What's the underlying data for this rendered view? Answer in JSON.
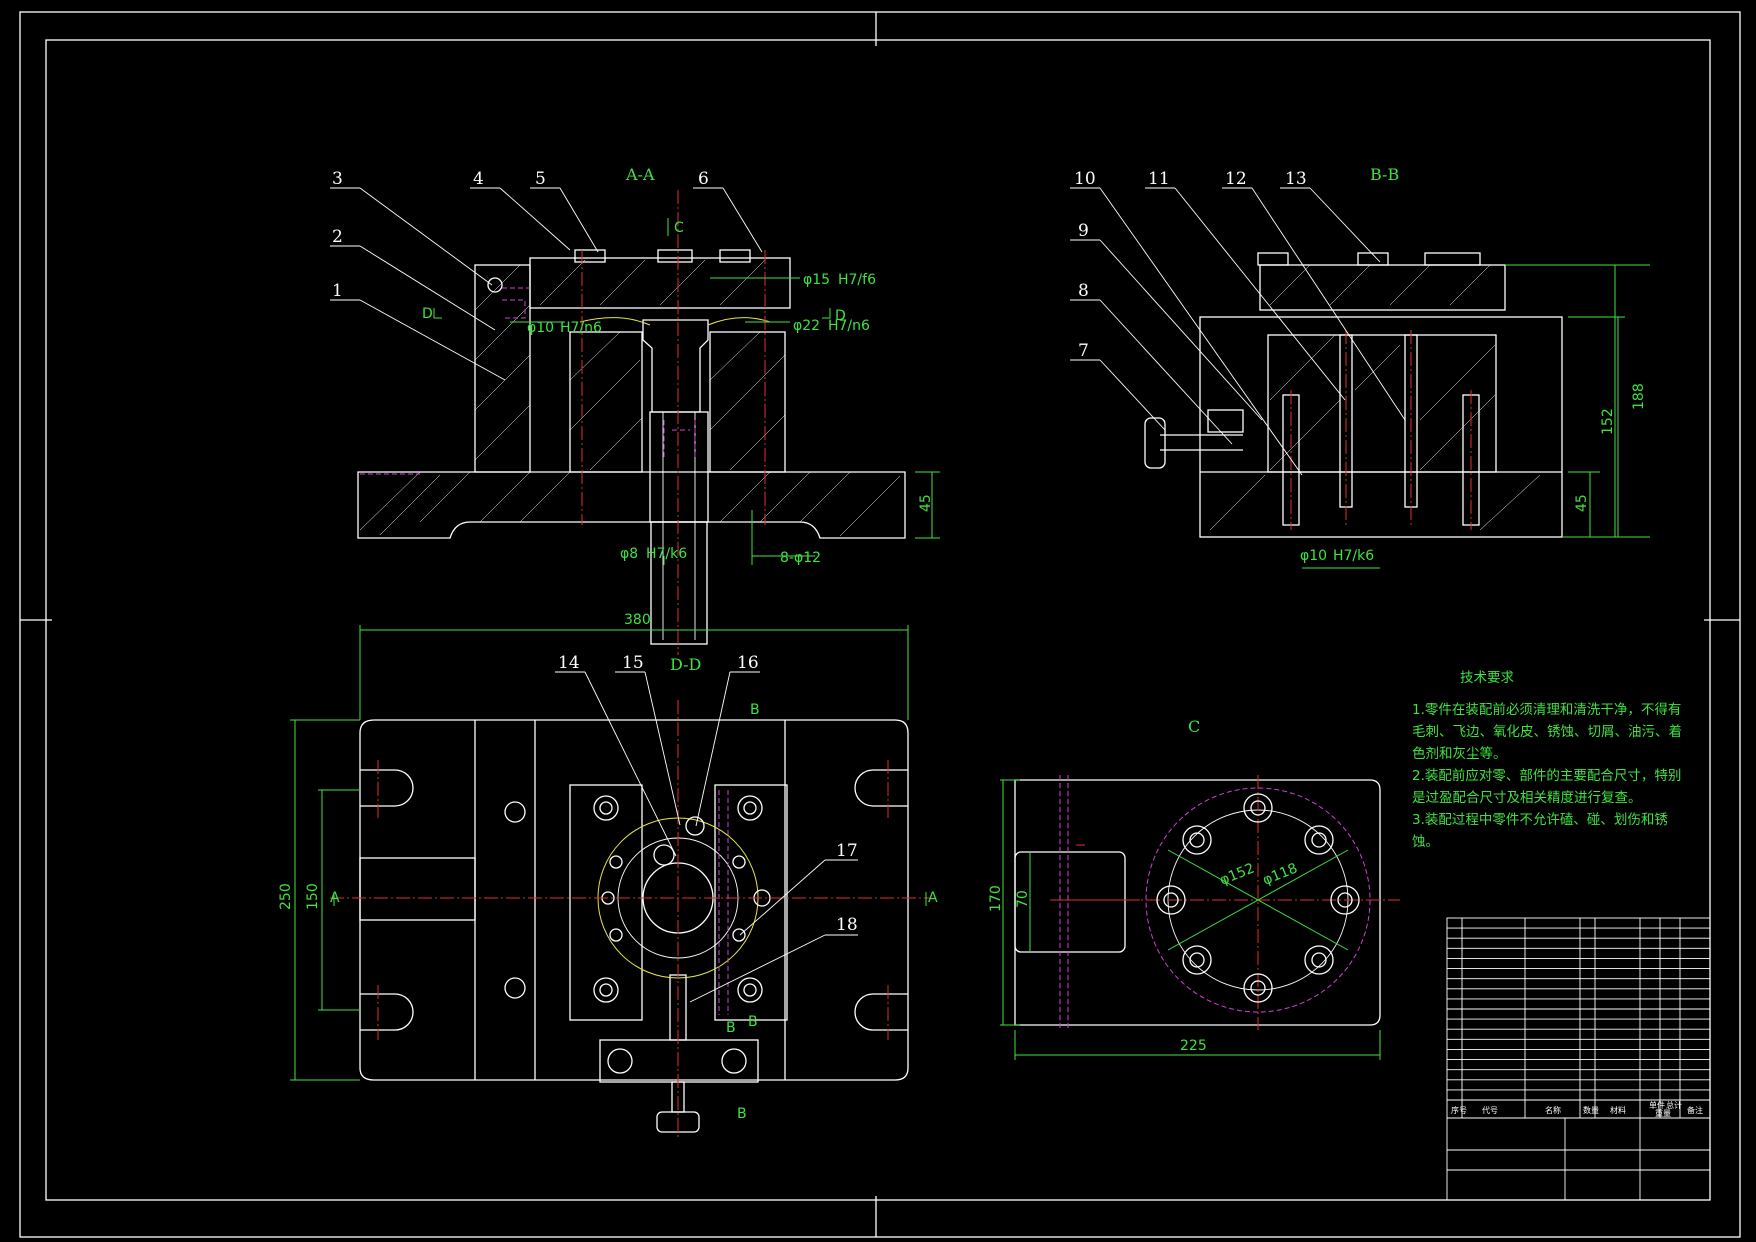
{
  "drawing": {
    "colors": {
      "background": "#000000",
      "outline": "#ffffff",
      "dimension": "#3fe23f",
      "centerline": "#e03030",
      "hidden": "#d33fd8"
    },
    "views": {
      "section_aa": "A-A",
      "section_bb": "B-B",
      "section_dd": "D-D",
      "view_c": "C"
    },
    "cut_marks": {
      "c": "C",
      "d_left": "D",
      "d_right": "D",
      "a_left": "A",
      "a_right": "A",
      "b1": "B",
      "b2": "B",
      "b3": "B",
      "b4": "B"
    },
    "balloons": [
      "1",
      "2",
      "3",
      "4",
      "5",
      "6",
      "7",
      "8",
      "9",
      "10",
      "11",
      "12",
      "13",
      "14",
      "15",
      "16",
      "17",
      "18"
    ],
    "dimensions": {
      "d1": "φ15",
      "d1_fit": "H7/f6",
      "d2": "φ22",
      "d2_fit": "H7/n6",
      "d3": "φ10",
      "d3_fit": "H7/n6",
      "d4": "φ8",
      "d4_fit": "H7/k6",
      "d5": "8-φ12",
      "d6": "45",
      "d7": "380",
      "d8": "250",
      "d9": "150",
      "d10": "188",
      "d11": "152",
      "d12": "45",
      "d13": "φ10",
      "d13_fit": "H7/k6",
      "d14": "170",
      "d15": "70",
      "d16": "225",
      "d17": "φ152",
      "d18": "φ118"
    },
    "tech_requirements": {
      "title": "技术要求",
      "lines": [
        "1.零件在装配前必须清理和清洗干净，不得有",
        "毛刺、飞边、氧化皮、锈蚀、切屑、油污、着",
        "色剂和灰尘等。",
        "2.装配前应对零、部件的主要配合尺寸，特别",
        "是过盈配合尺寸及相关精度进行复查。",
        "3.装配过程中零件不允许磕、碰、划伤和锈",
        "蚀。"
      ]
    },
    "title_block": {
      "header": [
        "序号",
        "代号",
        "名称",
        "数量",
        "材料",
        "单件",
        "总计",
        "重量",
        "备注"
      ]
    }
  }
}
